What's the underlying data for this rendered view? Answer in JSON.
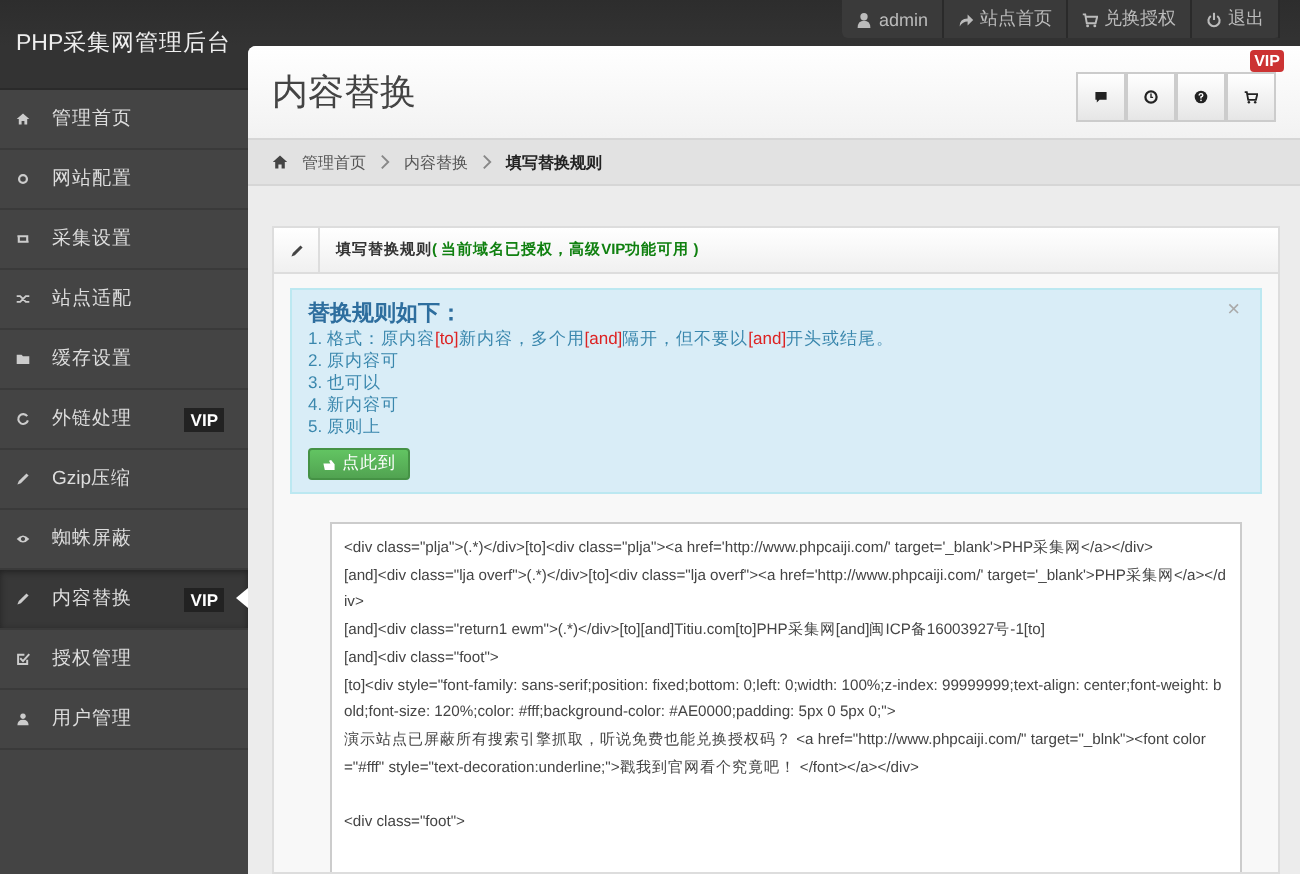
{
  "brand": "PHP采集网管理后台",
  "top_links": [
    {
      "label": "admin"
    },
    {
      "label": "站点首页"
    },
    {
      "label": "兑换授权"
    },
    {
      "label": "退出"
    }
  ],
  "sidebar": {
    "items": [
      {
        "label": "管理首页",
        "selected": false
      },
      {
        "label": "网站配置",
        "selected": false
      },
      {
        "label": "采集设置",
        "selected": false
      },
      {
        "label": "站点适配",
        "selected": false
      },
      {
        "label": "缓存设置",
        "selected": false
      },
      {
        "label": "外链处理",
        "badge": "VIP",
        "selected": false
      },
      {
        "label": "Gzip压缩",
        "selected": false
      },
      {
        "label": "蜘蛛屏蔽",
        "selected": false
      },
      {
        "label": "内容替换",
        "badge": "VIP",
        "selected": true
      },
      {
        "label": "授权管理",
        "selected": false
      },
      {
        "label": "用户管理",
        "selected": false
      }
    ]
  },
  "page_title": "内容替换",
  "vip_badge": "VIP",
  "breadcrumb": [
    {
      "label": "管理首页",
      "current": false
    },
    {
      "label": "内容替换",
      "current": false
    },
    {
      "label": "填写替换规则",
      "current": true
    }
  ],
  "panel": {
    "title": "填写替换规则",
    "note": "( 当前域名已授权，高级VIP功能可用 )",
    "alert": {
      "heading": "替换规则如下：",
      "close": "×",
      "lines": [
        "1. 格式：原内容**[to]**新内容，多个用**[and]**隔开，但不要以**[and]**开头或结尾。",
        "2. 原内容可",
        "3. 也可以",
        "4. 新内容可",
        "5. 原则上"
      ],
      "button": "点此到"
    },
    "editor": "<div class=\"plja\">(.*)</div>[to]<div class=\"plja\"><a href='http://www.phpcaiji.com/' target='_blank'>PHP采集网</a></div>\n[and]<div class=\"lja overf\">(.*)</div>[to]<div class=\"lja overf\"><a href='http://www.phpcaiji.com/' target='_blank'>PHP采集网</a></div>\n[and]<div class=\"return1 ewm\">(.*)</div>[to][and]Titiu.com[to]PHP采集网[and]闽ICP备16003927号-1[to]\n[and]<div class=\"foot\">\n[to]<div style=\"font-family: sans-serif;position: fixed;bottom: 0;left: 0;width: 100%;z-index: 99999999;text-align: center;font-weight: bold;font-size: 120%;color: #fff;background-color: #AE0000;padding: 5px 0 5px 0;\">\n演示站点已屏蔽所有搜索引擎抓取，听说免费也能兑换授权码？ <a href=\"http://www.phpcaiji.com/\" target=\"_blnk\"><font color=\"#fff\" style=\"text-decoration:underline;\">戳我到官网看个究竟吧！ </font></a></div>\n\n<div class=\"foot\">"
  }
}
